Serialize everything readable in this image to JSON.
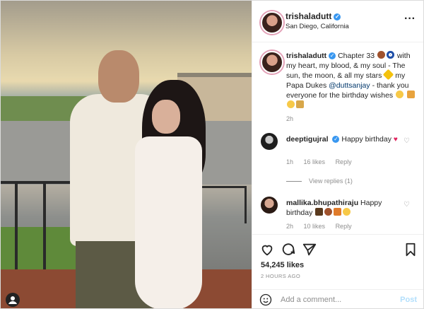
{
  "post": {
    "username": "trishaladutt",
    "location": "San Diego, California",
    "more_icon": "more-horizontal-icon"
  },
  "caption": {
    "username": "trishaladutt",
    "text_part1": "Chapter 33",
    "text_part2": "with my heart, my blood, & my soul - The sun, the moon, & all my stars",
    "text_part3": "my Papa Dukes",
    "mention": "@duttsanjay",
    "text_part4": "- thank you everyone for the birthday wishes",
    "time": "2h"
  },
  "comments": [
    {
      "username": "deeptigujral",
      "text": "Happy birthday",
      "time": "1h",
      "likes": "16 likes",
      "reply": "Reply"
    },
    {
      "username": "mallika.bhupathiraju",
      "text": "Happy birthday",
      "time": "2h",
      "likes": "10 likes",
      "reply": "Reply"
    }
  ],
  "view_replies": "View replies (1)",
  "likes_count": "54,245 likes",
  "posted_ago": "2 HOURS AGO",
  "add_comment_placeholder": "Add a comment...",
  "post_button": "Post",
  "colors": {
    "verified": "#3897f0",
    "mention": "#00376b",
    "post_disabled": "#b2dffc"
  }
}
